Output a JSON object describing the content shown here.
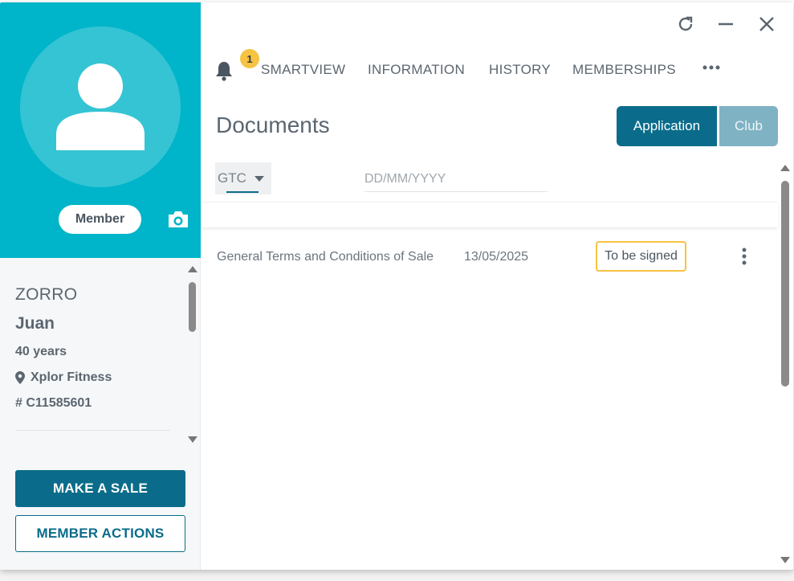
{
  "profile": {
    "badge": "Member",
    "last_name": "ZORRO",
    "first_name": "Juan",
    "age": "40 years",
    "club": "Xplor Fitness",
    "id": "# C11585601"
  },
  "actions": {
    "sale_label": "MAKE A SALE",
    "member_actions_label": "MEMBER ACTIONS"
  },
  "notifications": {
    "count": "1"
  },
  "tabs": [
    {
      "label": "SMARTVIEW"
    },
    {
      "label": "INFORMATION"
    },
    {
      "label": "HISTORY"
    },
    {
      "label": "MEMBERSHIPS"
    }
  ],
  "documents": {
    "title": "Documents",
    "scope_options": [
      {
        "label": "Application",
        "selected": true
      },
      {
        "label": "Club",
        "selected": false
      }
    ],
    "filter_type": "GTC",
    "date_placeholder": "DD/MM/YYYY",
    "rows": [
      {
        "name": "General Terms and Conditions of Sale",
        "date": "13/05/2025",
        "status": "To be signed"
      }
    ]
  },
  "colors": {
    "hero": "#00b5c9",
    "primary": "#0a6c8a",
    "segment_inactive": "#7fb3c4",
    "badge": "#f6c343"
  },
  "icons": [
    "user-icon",
    "camera-icon",
    "location-pin-icon",
    "bell-icon",
    "refresh-icon",
    "minimize-icon",
    "close-icon",
    "more-horizontal-icon",
    "more-vertical-icon"
  ]
}
